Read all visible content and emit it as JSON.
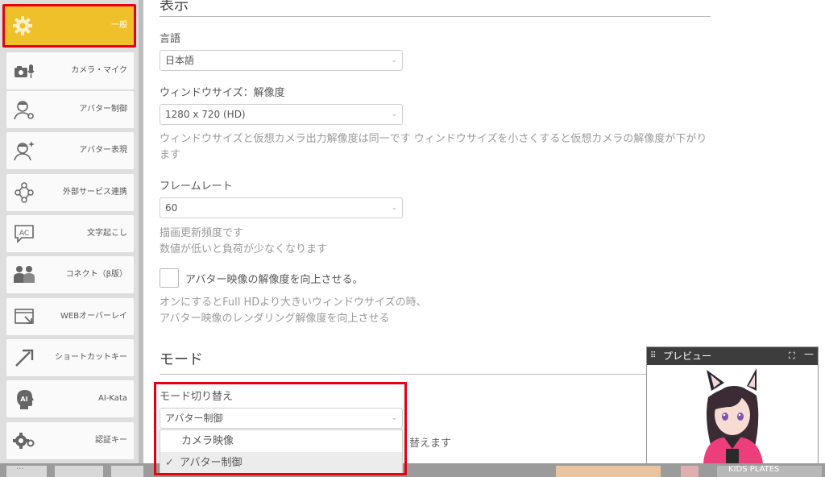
{
  "sidebar": {
    "items": [
      {
        "label": "一般",
        "icon": "gear-icon",
        "active": true
      },
      {
        "label": "カメラ・マイク",
        "icon": "camera-mic-icon"
      },
      {
        "label": "アバター制御",
        "icon": "avatar-control-icon"
      },
      {
        "label": "アバター表現",
        "icon": "avatar-expression-icon"
      },
      {
        "label": "外部サービス連携",
        "icon": "external-service-icon"
      },
      {
        "label": "文字起こし",
        "icon": "ac-icon",
        "icon_text": "AC"
      },
      {
        "label": "コネクト（β版）",
        "icon": "connect-icon"
      },
      {
        "label": "WEBオーバーレイ",
        "icon": "web-overlay-icon"
      },
      {
        "label": "ショートカットキー",
        "icon": "shortcut-arrow-icon"
      },
      {
        "label": "AI-Kata",
        "icon": "ai-head-icon",
        "icon_text": "AI"
      },
      {
        "label": "認証キー",
        "icon": "key-icon"
      }
    ],
    "accent_color": "#f0c02b",
    "highlight_color": "#e60012"
  },
  "display": {
    "title": "表示",
    "language": {
      "label": "言語",
      "value": "日本語"
    },
    "window_size": {
      "label": "ウィンドウサイズ：解像度",
      "value": "1280 x 720 (HD)",
      "note": "ウィンドウサイズと仮想カメラ出力解像度は同一です ウィンドウサイズを小さくすると仮想カメラの解像度が下がります"
    },
    "frame_rate": {
      "label": "フレームレート",
      "value": "60",
      "note_line1": "描画更新頻度です",
      "note_line2": "数値が低いと負荷が少なくなります"
    },
    "upscale": {
      "label": "アバター映像の解像度を向上させる。",
      "checked": false,
      "note_line1": "オンにするとFull HDより大きいウィンドウサイズの時、",
      "note_line2": "アバター映像のレンダリング解像度を向上させる"
    }
  },
  "mode": {
    "title": "モード",
    "switch_label": "モード切り替え",
    "value": "アバター制御",
    "options": [
      {
        "label": "カメラ映像",
        "selected": false
      },
      {
        "label": "アバター制御",
        "selected": true
      }
    ],
    "check_glyph": "✓",
    "hint_tail": "替えます"
  },
  "preview": {
    "title": "プレビュー",
    "grip_glyph": "⠿",
    "max_glyph": "⛶",
    "min_glyph": "—"
  },
  "dropdown_arrow": "⌄",
  "taskbar": {
    "dots": "···",
    "badge_text": "KIDS PLATES"
  }
}
